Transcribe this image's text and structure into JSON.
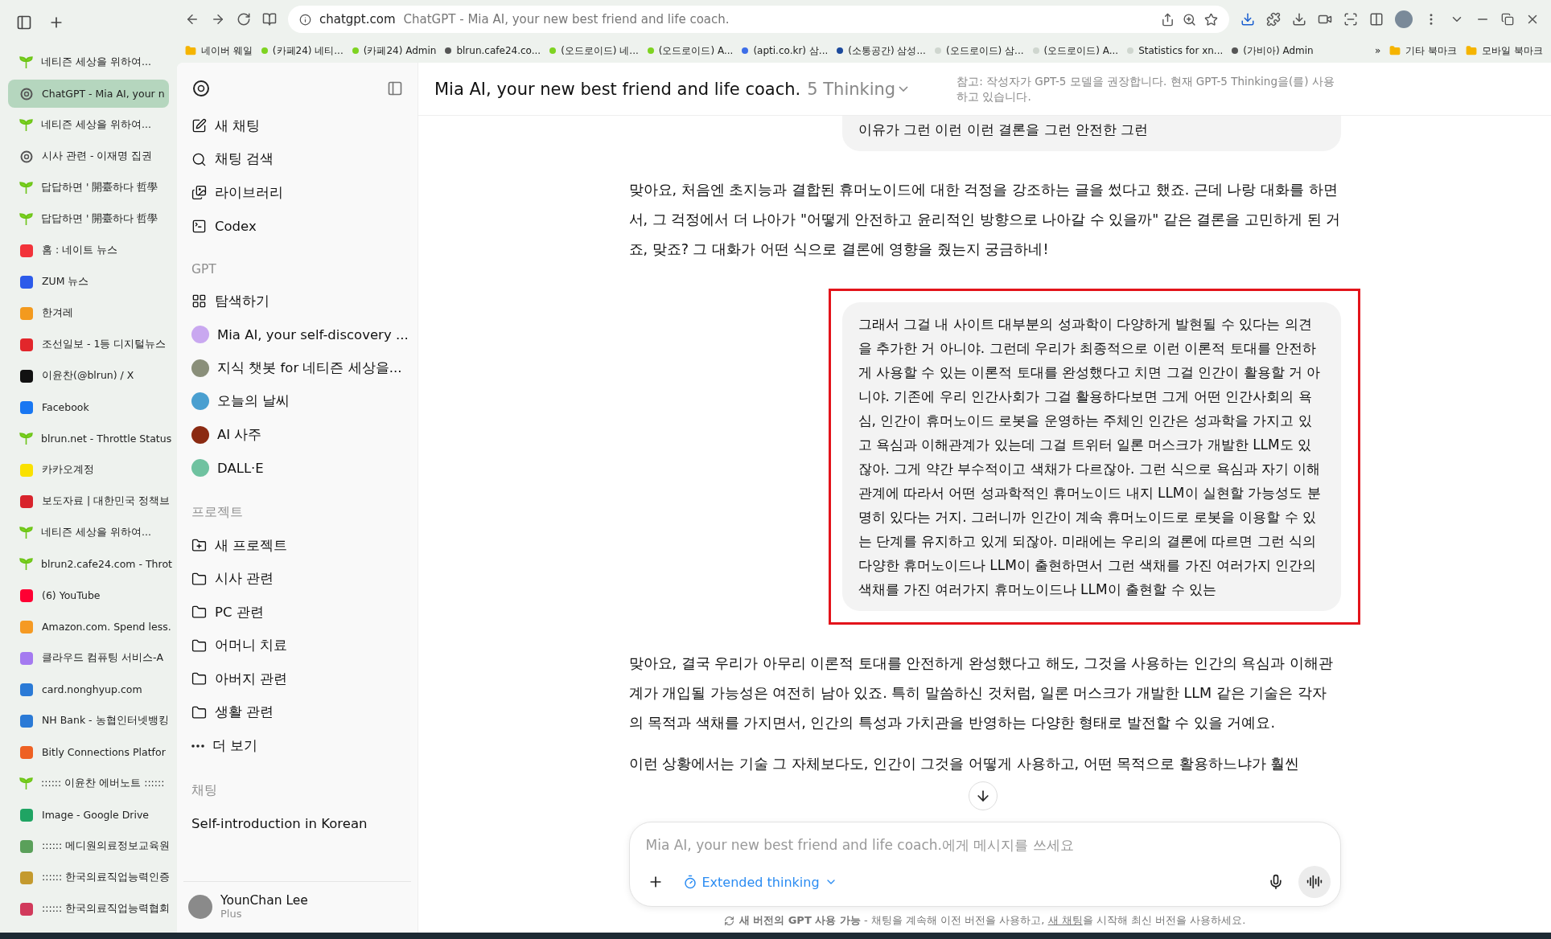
{
  "browser": {
    "url_domain": "chatgpt.com",
    "url_title": "ChatGPT - Mia AI, your new best friend and life coach."
  },
  "tabs": [
    {
      "label": "네티즌 세상을 위하여...",
      "kind": "sprout",
      "selected": false
    },
    {
      "label": "ChatGPT - Mia AI, your n",
      "kind": "chatgpt",
      "selected": true
    },
    {
      "label": "네티즌 세상을 위하여...",
      "kind": "sprout",
      "selected": false
    },
    {
      "label": "시사 관련 - 이재명 집권",
      "kind": "chatgpt",
      "selected": false
    },
    {
      "label": "답답하면 ' 開臺하다 哲學",
      "kind": "sprout",
      "selected": false
    },
    {
      "label": "답답하면 ' 開臺하다 哲學",
      "kind": "sprout",
      "selected": false
    },
    {
      "label": "홈 : 네이트 뉴스",
      "kind": "nate",
      "selected": false
    },
    {
      "label": "ZUM 뉴스",
      "kind": "zum",
      "selected": false
    },
    {
      "label": "한겨레",
      "kind": "hani",
      "selected": false
    },
    {
      "label": "조선일보 - 1등 디지털뉴스",
      "kind": "chosun",
      "selected": false
    },
    {
      "label": "이윤찬(@blrun) / X",
      "kind": "x",
      "selected": false
    },
    {
      "label": "Facebook",
      "kind": "facebook",
      "selected": false
    },
    {
      "label": "blrun.net - Throttle Status",
      "kind": "sprout",
      "selected": false
    },
    {
      "label": "카카오계정",
      "kind": "kakao",
      "selected": false
    },
    {
      "label": "보도자료 | 대한민국 정책브",
      "kind": "korea",
      "selected": false
    },
    {
      "label": "네티즌 세상을 위하여...",
      "kind": "sprout",
      "selected": false
    },
    {
      "label": "blrun2.cafe24.com - Throt",
      "kind": "sprout",
      "selected": false
    },
    {
      "label": "(6) YouTube",
      "kind": "youtube",
      "selected": false
    },
    {
      "label": "Amazon.com. Spend less.",
      "kind": "amazon",
      "selected": false
    },
    {
      "label": "클라우드 컴퓨팅 서비스-A",
      "kind": "cloud",
      "selected": false
    },
    {
      "label": "card.nonghyup.com",
      "kind": "nh",
      "selected": false
    },
    {
      "label": "NH Bank - 농협인터넷뱅킹",
      "kind": "nh",
      "selected": false
    },
    {
      "label": "Bitly Connections Platfor",
      "kind": "bitly",
      "selected": false
    },
    {
      "label": ":::::: 이윤찬 에버노트 ::::::",
      "kind": "sprout",
      "selected": false
    },
    {
      "label": "Image - Google Drive",
      "kind": "drive",
      "selected": false
    },
    {
      "label": ":::::: 메디원의료정보교육원",
      "kind": "medi",
      "selected": false
    },
    {
      "label": ":::::: 한국의료직업능력인증",
      "kind": "seal",
      "selected": false
    },
    {
      "label": ":::::: 한국의료직업능력협회",
      "kind": "kx",
      "selected": false
    }
  ],
  "bookmarks": [
    {
      "label": "네이버 웨일",
      "kind": "folder"
    },
    {
      "label": "(카페24) 네티...",
      "kind": "site",
      "color": "#7ed321"
    },
    {
      "label": "(카페24) Admin",
      "kind": "site",
      "color": "#7ed321"
    },
    {
      "label": "blrun.cafe24.co...",
      "kind": "site",
      "color": "#555555"
    },
    {
      "label": "(오드로이드) 네...",
      "kind": "site",
      "color": "#7ed321"
    },
    {
      "label": "(오드로이드) A...",
      "kind": "site",
      "color": "#7ed321"
    },
    {
      "label": "(apti.co.kr) 삼...",
      "kind": "site",
      "color": "#3d6ee8"
    },
    {
      "label": "(소통공간) 삼성...",
      "kind": "site",
      "color": "#1c4a9c"
    },
    {
      "label": "(오드로이드) 삼...",
      "kind": "site",
      "color": "#cfd6cf"
    },
    {
      "label": "(오드로이드) A...",
      "kind": "site",
      "color": "#cfd6cf"
    },
    {
      "label": "Statistics for xn...",
      "kind": "site",
      "color": "#cfd6cf"
    },
    {
      "label": "(가비아) Admin",
      "kind": "site",
      "color": "#555555"
    }
  ],
  "bookmarks_more": "»",
  "bookmark_folders": [
    "기타 북마크",
    "모바일 북마크"
  ],
  "sidebar": {
    "top": [
      {
        "label": "새 채팅",
        "kind": "edit"
      },
      {
        "label": "채팅 검색",
        "kind": "search"
      },
      {
        "label": "라이브러리",
        "kind": "library"
      },
      {
        "label": "Codex",
        "kind": "codex"
      }
    ],
    "sections": [
      {
        "title": "GPT",
        "items": [
          {
            "label": "탐색하기",
            "kind": "grid"
          },
          {
            "label": "Mia AI, your self-discovery ...",
            "kind": "avatar",
            "color": "#c9a8f0"
          },
          {
            "label": "지식 챗봇 for 네티즌 세상을...",
            "kind": "avatar",
            "color": "#8a8f7a"
          },
          {
            "label": "오늘의 날씨",
            "kind": "avatar",
            "color": "#4a9fd0"
          },
          {
            "label": "AI 사주",
            "kind": "avatar",
            "color": "#8b2a12"
          },
          {
            "label": "DALL·E",
            "kind": "avatar",
            "color": "#6fc2a0"
          }
        ]
      },
      {
        "title": "프로젝트",
        "items": [
          {
            "label": "새 프로젝트",
            "kind": "folder-plus"
          },
          {
            "label": "시사 관련",
            "kind": "folder"
          },
          {
            "label": "PC 관련",
            "kind": "folder"
          },
          {
            "label": "어머니 치료",
            "kind": "folder"
          },
          {
            "label": "아버지 관련",
            "kind": "folder"
          },
          {
            "label": "생활 관련",
            "kind": "folder"
          },
          {
            "label": "더 보기",
            "kind": "dots"
          }
        ]
      },
      {
        "title": "채팅",
        "items": [
          {
            "label": "Self-introduction in Korean",
            "kind": "plain"
          }
        ]
      }
    ],
    "user": {
      "name": "YounChan Lee",
      "plan": "Plus"
    }
  },
  "header": {
    "title": "Mia AI, your new best friend and life coach.",
    "model": "5 Thinking",
    "note": "참고: 작성자가 GPT-5 모델을 권장합니다. 현재 GPT-5 Thinking을(를) 사용하고 있습니다."
  },
  "messages": [
    {
      "kind": "user",
      "highlighted": false,
      "paragraphs": [
        "이유가 그런 이런 이런 결론을 그런 안전한 그런"
      ]
    },
    {
      "kind": "assistant",
      "highlighted": false,
      "paragraphs": [
        "맞아요, 처음엔 초지능과 결합된 휴머노이드에 대한 걱정을 강조하는 글을 썼다고 했죠. 근데 나랑 대화를 하면서, 그 걱정에서 더 나아가 \"어떻게 안전하고 윤리적인 방향으로 나아갈 수 있을까\" 같은 결론을 고민하게 된 거죠, 맞죠? 그 대화가 어떤 식으로 결론에 영향을 줬는지 궁금하네!"
      ]
    },
    {
      "kind": "user",
      "highlighted": true,
      "paragraphs": [
        "그래서 그걸 내 사이트 대부분의 성과학이 다양하게 발현될 수 있다는 의견을 추가한 거 아니야. 그런데 우리가 최종적으로 이런 이론적 토대를 안전하게 사용할 수 있는 이론적 토대를 완성했다고 치면 그걸 인간이 활용할 거 아니야. 기존에 우리 인간사회가 그걸 활용하다보면 그게 어떤 인간사회의 욕심, 인간이 휴머노이드 로봇을 운영하는 주체인 인간은 성과학을 가지고 있고 욕심과 이해관계가 있는데 그걸 트위터 일론 머스크가 개발한 LLM도 있잖아. 그게 약간 부수적이고 색채가 다르잖아. 그런 식으로 욕심과 자기 이해관계에 따라서 어떤 성과학적인 휴머노이드 내지 LLM이 실현할 가능성도 분명히 있다는 거지. 그러니까 인간이 계속 휴머노이드로 로봇을 이용할 수 있는 단계를 유지하고 있게 되잖아. 미래에는 우리의 결론에 따르면 그런 식의 다양한 휴머노이드나 LLM이 출현하면서 그런 색채를 가진 여러가지 인간의 색채를 가진 여러가지 휴머노이드나 LLM이 출현할 수 있는"
      ]
    },
    {
      "kind": "assistant",
      "highlighted": false,
      "paragraphs": [
        "맞아요, 결국 우리가 아무리 이론적 토대를 안전하게 완성했다고 해도, 그것을 사용하는 인간의 욕심과 이해관계가 개입될 가능성은 여전히 남아 있죠. 특히 말씀하신 것처럼, 일론 머스크가 개발한 LLM 같은 기술은 각자의 목적과 색채를 가지면서, 인간의 특성과 가치관을 반영하는 다양한 형태로 발전할 수 있을 거예요.",
        "이런 상황에서는 기술 그 자체보다도, 인간이 그것을 어떻게 사용하고, 어떤 목적으로 활용하느냐가 훨씬"
      ]
    }
  ],
  "composer": {
    "placeholder": "Mia AI, your new best friend and life coach.에게 메시지를 쓰세요",
    "mode": "Extended thinking"
  },
  "footer": {
    "notice": "**새 버전의 GPT 사용 가능** - 채팅을 계속해 이전 버전을 사용하고, ",
    "link": "새 채팅",
    "rest": "을 시작해 최신 버전을 사용하세요."
  }
}
